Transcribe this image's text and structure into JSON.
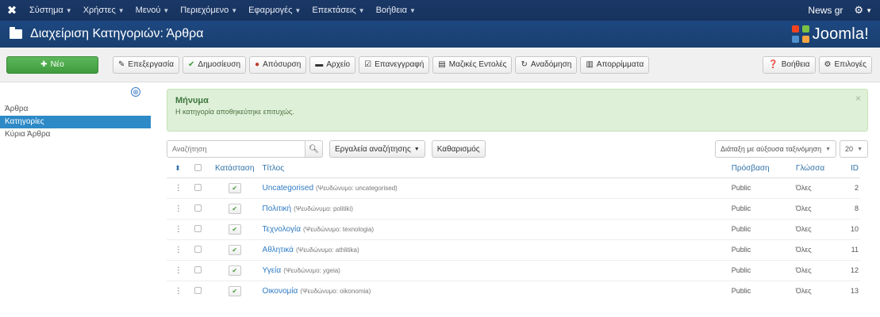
{
  "topbar": {
    "logo_icon": "joomla-icon",
    "menu": [
      {
        "label": "Σύστημα"
      },
      {
        "label": "Χρήστες"
      },
      {
        "label": "Μενού"
      },
      {
        "label": "Περιεχόμενο"
      },
      {
        "label": "Εφαρμογές"
      },
      {
        "label": "Επεκτάσεις"
      },
      {
        "label": "Βοήθεια"
      }
    ],
    "site_label": "News gr",
    "user_icon": "gear-icon"
  },
  "header": {
    "title": "Διαχείριση Κατηγοριών: Άρθρα",
    "brand": "Joomla!"
  },
  "toolbar": {
    "new_label": "Νέο",
    "edit_label": "Επεξεργασία",
    "publish_label": "Δημοσίευση",
    "unpublish_label": "Απόσυρση",
    "archive_label": "Αρχείο",
    "batch_label": "Επανεγγραφή",
    "checkin_label": "Μαζικές Εντολές",
    "rebuild_label": "Αναδόμηση",
    "trash_label": "Απορρίμματα",
    "help_label": "Βοήθεια",
    "options_label": "Επιλογές"
  },
  "sidebar": {
    "items": [
      {
        "label": "Άρθρα",
        "active": false
      },
      {
        "label": "Κατηγορίες",
        "active": true
      },
      {
        "label": "Κύρια Άρθρα",
        "active": false
      }
    ]
  },
  "message": {
    "heading": "Μήνυμα",
    "text": "Η κατηγορία αποθηκεύτηκε επιτυχώς."
  },
  "filters": {
    "search_placeholder": "Αναζήτηση",
    "tools_label": "Εργαλεία αναζήτησης",
    "clear_label": "Καθαρισμός",
    "sort_value": "Διάταξη με αύξουσα ταξινόμηση",
    "limit_value": "20"
  },
  "table": {
    "headers": {
      "status": "Κατάσταση",
      "title": "Τίτλος",
      "access": "Πρόσβαση",
      "language": "Γλώσσα",
      "id": "ID"
    },
    "rows": [
      {
        "title": "Uncategorised",
        "alias": "(Ψευδώνυμο: uncategorised)",
        "access": "Public",
        "language": "Όλες",
        "id": "2"
      },
      {
        "title": "Πολιτική",
        "alias": "(Ψευδώνυμο: politiki)",
        "access": "Public",
        "language": "Όλες",
        "id": "8"
      },
      {
        "title": "Τεχνολογία",
        "alias": "(Ψευδώνυμο: texnologia)",
        "access": "Public",
        "language": "Όλες",
        "id": "10"
      },
      {
        "title": "Αθλητικά",
        "alias": "(Ψευδώνυμο: athlitika)",
        "access": "Public",
        "language": "Όλες",
        "id": "11"
      },
      {
        "title": "Υγεία",
        "alias": "(Ψευδώνυμο: ygeia)",
        "access": "Public",
        "language": "Όλες",
        "id": "12"
      },
      {
        "title": "Οικονομία",
        "alias": "(Ψευδώνυμο: oikonomia)",
        "access": "Public",
        "language": "Όλες",
        "id": "13"
      }
    ]
  }
}
